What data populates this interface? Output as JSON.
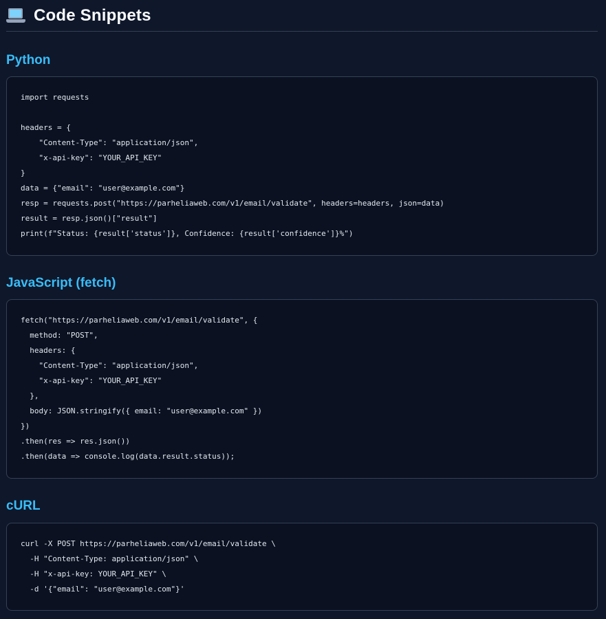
{
  "header": {
    "icon": "laptop-icon",
    "title": "Code Snippets"
  },
  "sections": [
    {
      "title": "Python",
      "code": "import requests\n\nheaders = {\n    \"Content-Type\": \"application/json\",\n    \"x-api-key\": \"YOUR_API_KEY\"\n}\ndata = {\"email\": \"user@example.com\"}\nresp = requests.post(\"https://parheliaweb.com/v1/email/validate\", headers=headers, json=data)\nresult = resp.json()[\"result\"]\nprint(f\"Status: {result['status']}, Confidence: {result['confidence']}%\")"
    },
    {
      "title": "JavaScript (fetch)",
      "code": "fetch(\"https://parheliaweb.com/v1/email/validate\", {\n  method: \"POST\",\n  headers: {\n    \"Content-Type\": \"application/json\",\n    \"x-api-key\": \"YOUR_API_KEY\"\n  },\n  body: JSON.stringify({ email: \"user@example.com\" })\n})\n.then(res => res.json())\n.then(data => console.log(data.result.status));"
    },
    {
      "title": "cURL",
      "code": "curl -X POST https://parheliaweb.com/v1/email/validate \\\n  -H \"Content-Type: application/json\" \\\n  -H \"x-api-key: YOUR_API_KEY\" \\\n  -d '{\"email\": \"user@example.com\"}'"
    }
  ],
  "colors": {
    "background": "#0f172a",
    "code_background": "#0b1120",
    "accent": "#38bdf8",
    "border": "#334155",
    "text": "#e2e8f0"
  }
}
